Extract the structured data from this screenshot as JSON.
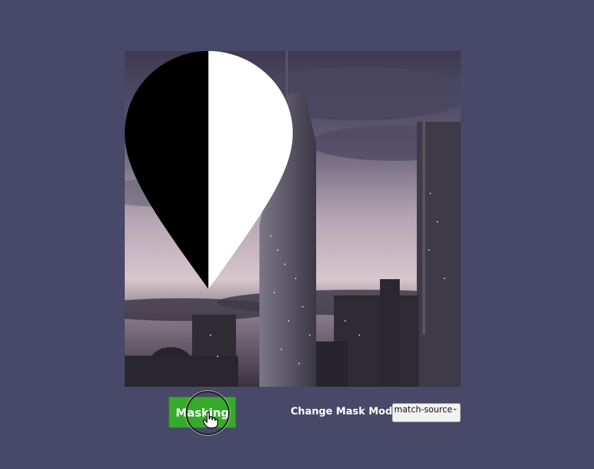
{
  "controls": {
    "mask_button_label": "Masking",
    "mode_label": "Change Mask Mode:",
    "mode_select_value": "match-source"
  },
  "colors": {
    "page_background": "#484868",
    "button_green": "#36ab2b",
    "mask_dark": "#000000",
    "mask_light": "#ffffff"
  },
  "icons": {
    "mask_shape": "map-pin-icon",
    "cursor": "hand-pointer-icon",
    "dropdown": "chevron-down-icon"
  }
}
